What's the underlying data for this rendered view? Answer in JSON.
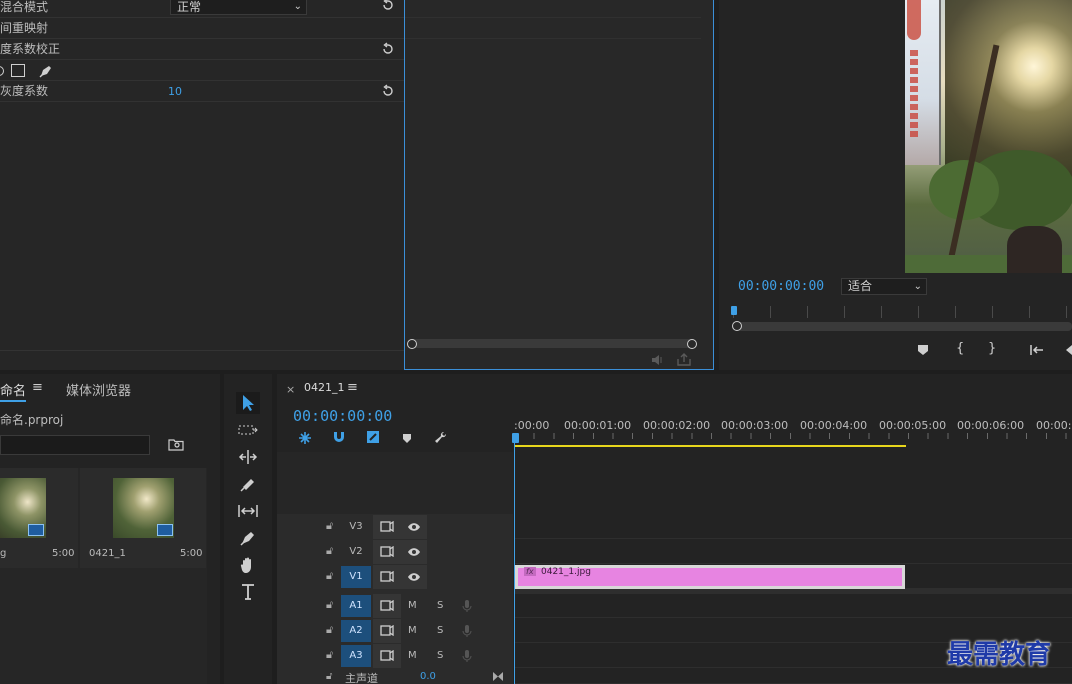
{
  "effect_controls": {
    "blend_mode_label": "混合模式",
    "blend_mode_value": "正常",
    "time_remap_label": "间重映射",
    "gamma_label": "度系数校正",
    "gray_label": "灰度系数",
    "gray_value": "10"
  },
  "program_monitor": {
    "timecode": "00:00:00:00",
    "fit_label": "适合"
  },
  "project_panel": {
    "tab_name": "命名",
    "tab_media_browser": "媒体浏览器",
    "project_file": "命名.prproj",
    "items": [
      {
        "name": "g",
        "duration": "5:00"
      },
      {
        "name": "0421_1",
        "duration": "5:00"
      }
    ]
  },
  "timeline": {
    "tab_name": "0421_1",
    "timecode": "00:00:00:00",
    "ruler_labels": [
      ":00:00",
      "00:00:01:00",
      "00:00:02:00",
      "00:00:03:00",
      "00:00:04:00",
      "00:00:05:00",
      "00:00:06:00",
      "00:00:0"
    ],
    "video_tracks": [
      "V3",
      "V2",
      "V1"
    ],
    "audio_tracks": [
      "A1",
      "A2",
      "A3"
    ],
    "mute_label": "M",
    "solo_label": "S",
    "master_label": "主声道",
    "master_value": "0.0",
    "clip_name": "0421_1.jpg",
    "clip_fx": "fx"
  },
  "watermark": "最需教育",
  "colors": {
    "accent_blue": "#3fa0e6",
    "clip_pink": "#e784e1",
    "work_area_yellow": "#e8d61c",
    "track_on": "#1d4f7c"
  }
}
